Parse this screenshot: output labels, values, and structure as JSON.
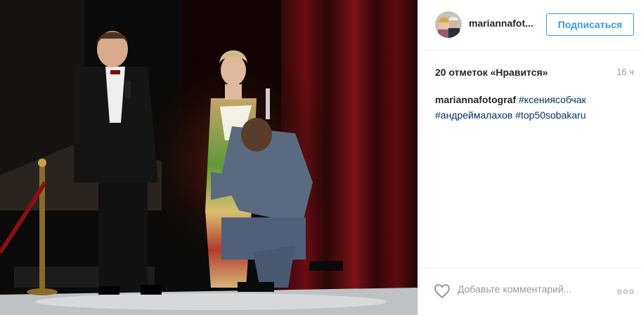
{
  "post": {
    "username": "mariannafot...",
    "follow_label": "Подписаться",
    "likes_text": "20 отметок «Нравится»",
    "age": "16 ч",
    "caption": {
      "author": "mariannafotograf",
      "tag1": "#ксениясобчак",
      "tag2": "#андреймалахов",
      "tag3": "#top50sobakaru"
    },
    "comment_placeholder": "Добавьте комментарий...",
    "more_icon": "ooo"
  },
  "icons": {
    "heart": "heart-icon",
    "more": "more-options-icon"
  },
  "colors": {
    "accent": "#3897f0",
    "hashtag": "#003569",
    "muted": "#999999"
  }
}
